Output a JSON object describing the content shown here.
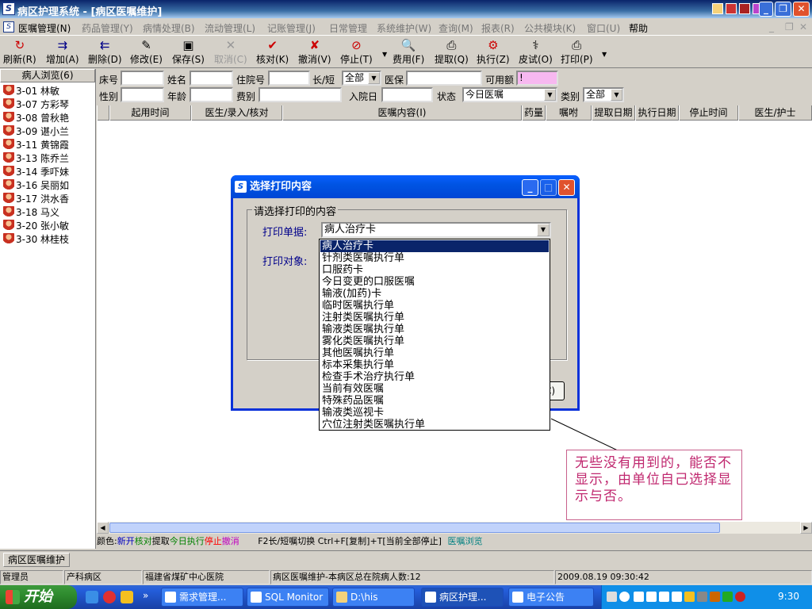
{
  "window": {
    "title": "病区护理系统 - [病区医嘱维护]"
  },
  "menubar": {
    "items": [
      "医嘱管理(N)",
      "药品管理(Y)",
      "病情处理(B)",
      "流动管理(L)",
      "记账管理(J)",
      "日常管理",
      "系统维护(W)",
      "查询(M)",
      "报表(R)",
      "公共模块(K)",
      "窗口(U)",
      "帮助"
    ]
  },
  "toolbar": {
    "buttons": [
      {
        "label": "刷新(R)",
        "icon": "refresh-icon"
      },
      {
        "label": "增加(A)",
        "icon": "add-icon"
      },
      {
        "label": "删除(D)",
        "icon": "delete-icon"
      },
      {
        "label": "修改(E)",
        "icon": "edit-icon"
      },
      {
        "label": "保存(S)",
        "icon": "save-icon"
      },
      {
        "label": "取消(C)",
        "icon": "cancel-icon"
      },
      {
        "label": "核对(K)",
        "icon": "check-icon"
      },
      {
        "label": "撤消(V)",
        "icon": "undo-icon"
      },
      {
        "label": "停止(T)",
        "icon": "stop-icon"
      },
      {
        "label": "费用(F)",
        "icon": "fee-icon"
      },
      {
        "label": "提取(Q)",
        "icon": "extract-icon"
      },
      {
        "label": "执行(Z)",
        "icon": "execute-icon"
      },
      {
        "label": "皮试(O)",
        "icon": "skintest-icon"
      },
      {
        "label": "打印(P)",
        "icon": "print-icon"
      }
    ]
  },
  "sidebar": {
    "header": "病人浏览(6)",
    "patients": [
      "3-01 林敏",
      "3-07 方彩琴",
      "3-08 曾秋艳",
      "3-09 谌小兰",
      "3-11 黄锦霞",
      "3-13 陈乔兰",
      "3-14 季吓妹",
      "3-16 吴丽如",
      "3-17 洪水香",
      "3-18 马义",
      "3-20 张小敏",
      "3-30 林桂枝"
    ]
  },
  "filters": {
    "bed": "床号",
    "name": "姓名",
    "admission_no": "住院号",
    "long_short": "长/短",
    "long_short_value": "全部",
    "insurance": "医保",
    "available": "可用额",
    "available_value": "!",
    "gender": "性别",
    "age": "年龄",
    "fee_type": "费别",
    "admit_date": "入院日",
    "status": "状态",
    "status_value": "今日医嘱",
    "category": "类别",
    "category_value": "全部"
  },
  "grid": {
    "columns": [
      "起用时间",
      "医生/录入/核对",
      "医嘱内容(I)",
      "药量",
      "嘱咐",
      "提取日期",
      "执行日期",
      "停止时间",
      "医生/护士"
    ]
  },
  "legend": {
    "prefix": "颜色:",
    "new": "新开",
    "checked": "核对",
    "extracted": "提取",
    "executed_today": "今日执行",
    "stopped": "停止",
    "cancelled": "撤消",
    "hint": "F2长/短嘱切换  Ctrl+F[复制]+T[当前全部停止]",
    "link": "医嘱浏览",
    "colors": {
      "new": "#0000c0",
      "checked": "#008000",
      "executed_today": "#008000",
      "stopped": "#ff0000",
      "cancelled": "#c000c0",
      "link": "#008080"
    }
  },
  "tab": "病区医嘱维护",
  "statusbar": {
    "user": "管理员",
    "ward": "产科病区",
    "hospital": "福建省煤矿中心医院",
    "info": "病区医嘱维护-本病区总在院病人数:12",
    "datetime": "2009.08.19 09:30:42"
  },
  "dialog": {
    "title": "选择打印内容",
    "group_title": "请选择打印的内容",
    "doc_label": "打印单据:",
    "target_label": "打印对象:",
    "selected": "病人治疗卡",
    "button_partial": "C)",
    "options": [
      "病人治疗卡",
      "针剂类医嘱执行单",
      "口服药卡",
      "今日变更的口服医嘱",
      "输液(加药)卡",
      "临时医嘱执行单",
      "注射类医嘱执行单",
      "输液类医嘱执行单",
      "雾化类医嘱执行单",
      "其他医嘱执行单",
      "标本采集执行单",
      "检查手术治疗执行单",
      "当前有效医嘱",
      "特殊药品医嘱",
      "输液类巡视卡",
      "穴位注射类医嘱执行单"
    ]
  },
  "annotation": {
    "text": "无些没有用到的，能否不显示，由单位自己选择显示与否。",
    "color": "#c0286f"
  },
  "taskbar": {
    "start": "开始",
    "tasks": [
      "需求管理...",
      "SQL Monitor",
      "D:\\his",
      "病区护理...",
      "电子公告"
    ],
    "clock": "9:30"
  }
}
